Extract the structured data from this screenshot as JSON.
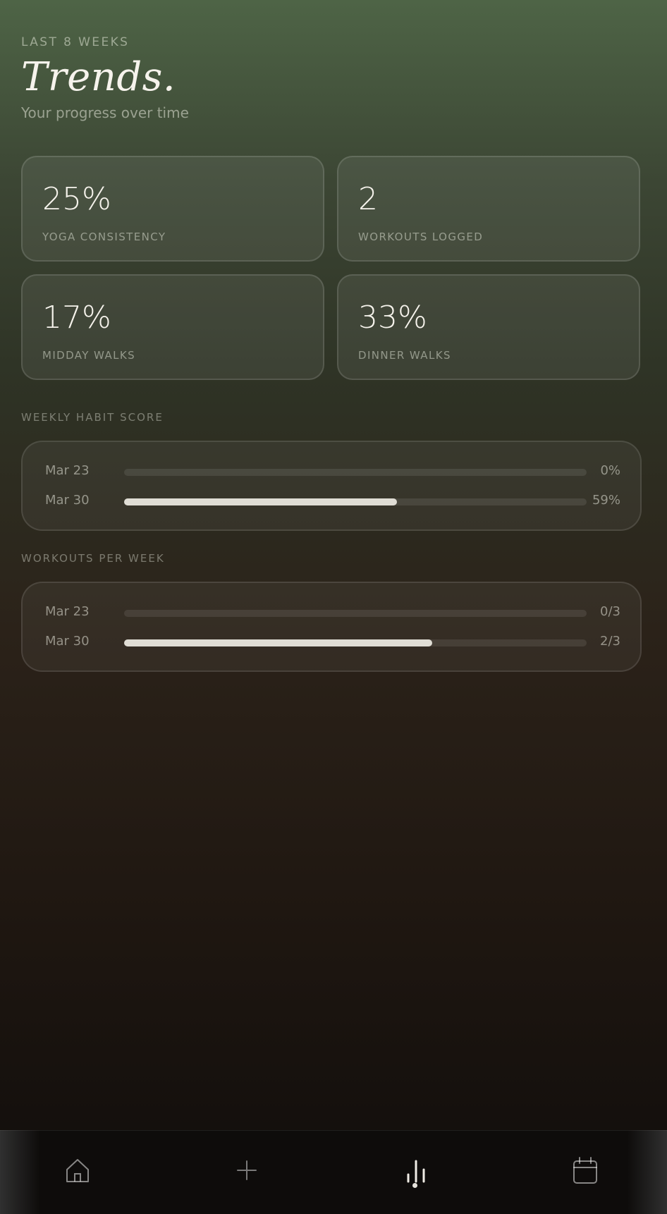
{
  "header": {
    "eyebrow": "LAST 8 WEEKS",
    "title": "Trends.",
    "subtitle": "Your progress over time"
  },
  "stats": [
    {
      "value": "25%",
      "label": "YOGA CONSISTENCY"
    },
    {
      "value": "2",
      "label": "WORKOUTS LOGGED"
    },
    {
      "value": "17%",
      "label": "MIDDAY WALKS"
    },
    {
      "value": "33%",
      "label": "DINNER WALKS"
    }
  ],
  "weekly_habit_score": {
    "label": "WEEKLY HABIT SCORE",
    "rows": [
      {
        "week": "Mar 23",
        "value_text": "0%",
        "fraction": 0
      },
      {
        "week": "Mar 30",
        "value_text": "59%",
        "fraction": 0.59
      }
    ]
  },
  "workouts_per_week": {
    "label": "WORKOUTS PER WEEK",
    "rows": [
      {
        "week": "Mar 23",
        "value_text": "0/3",
        "fraction": 0
      },
      {
        "week": "Mar 30",
        "value_text": "2/3",
        "fraction": 0.6667
      }
    ]
  },
  "nav": {
    "items": [
      {
        "icon": "home-icon",
        "active": false
      },
      {
        "icon": "plus-icon",
        "active": false
      },
      {
        "icon": "bar-chart-icon",
        "active": true
      },
      {
        "icon": "calendar-icon",
        "active": false
      }
    ]
  },
  "colors": {
    "accent": "#e0ddd5",
    "background_top": "#4e6446",
    "background_bottom": "#100d0b"
  }
}
